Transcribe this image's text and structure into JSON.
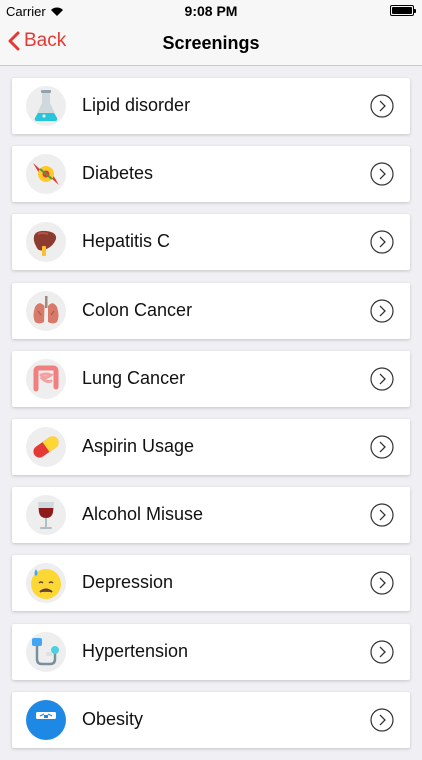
{
  "status_bar": {
    "carrier": "Carrier",
    "time": "9:08 PM"
  },
  "nav": {
    "back_label": "Back",
    "title": "Screenings"
  },
  "items": [
    {
      "label": "Lipid disorder",
      "icon": "flask-icon"
    },
    {
      "label": "Diabetes",
      "icon": "candy-icon"
    },
    {
      "label": "Hepatitis C",
      "icon": "liver-icon"
    },
    {
      "label": "Colon Cancer",
      "icon": "lungs-icon"
    },
    {
      "label": "Lung Cancer",
      "icon": "intestine-icon"
    },
    {
      "label": "Aspirin Usage",
      "icon": "pill-icon"
    },
    {
      "label": "Alcohol Misuse",
      "icon": "wine-glass-icon"
    },
    {
      "label": "Depression",
      "icon": "sad-face-icon"
    },
    {
      "label": "Hypertension",
      "icon": "blood-pressure-icon"
    },
    {
      "label": "Obesity",
      "icon": "scale-icon"
    }
  ],
  "colors": {
    "accent": "#e53935",
    "background": "#efeff4"
  }
}
